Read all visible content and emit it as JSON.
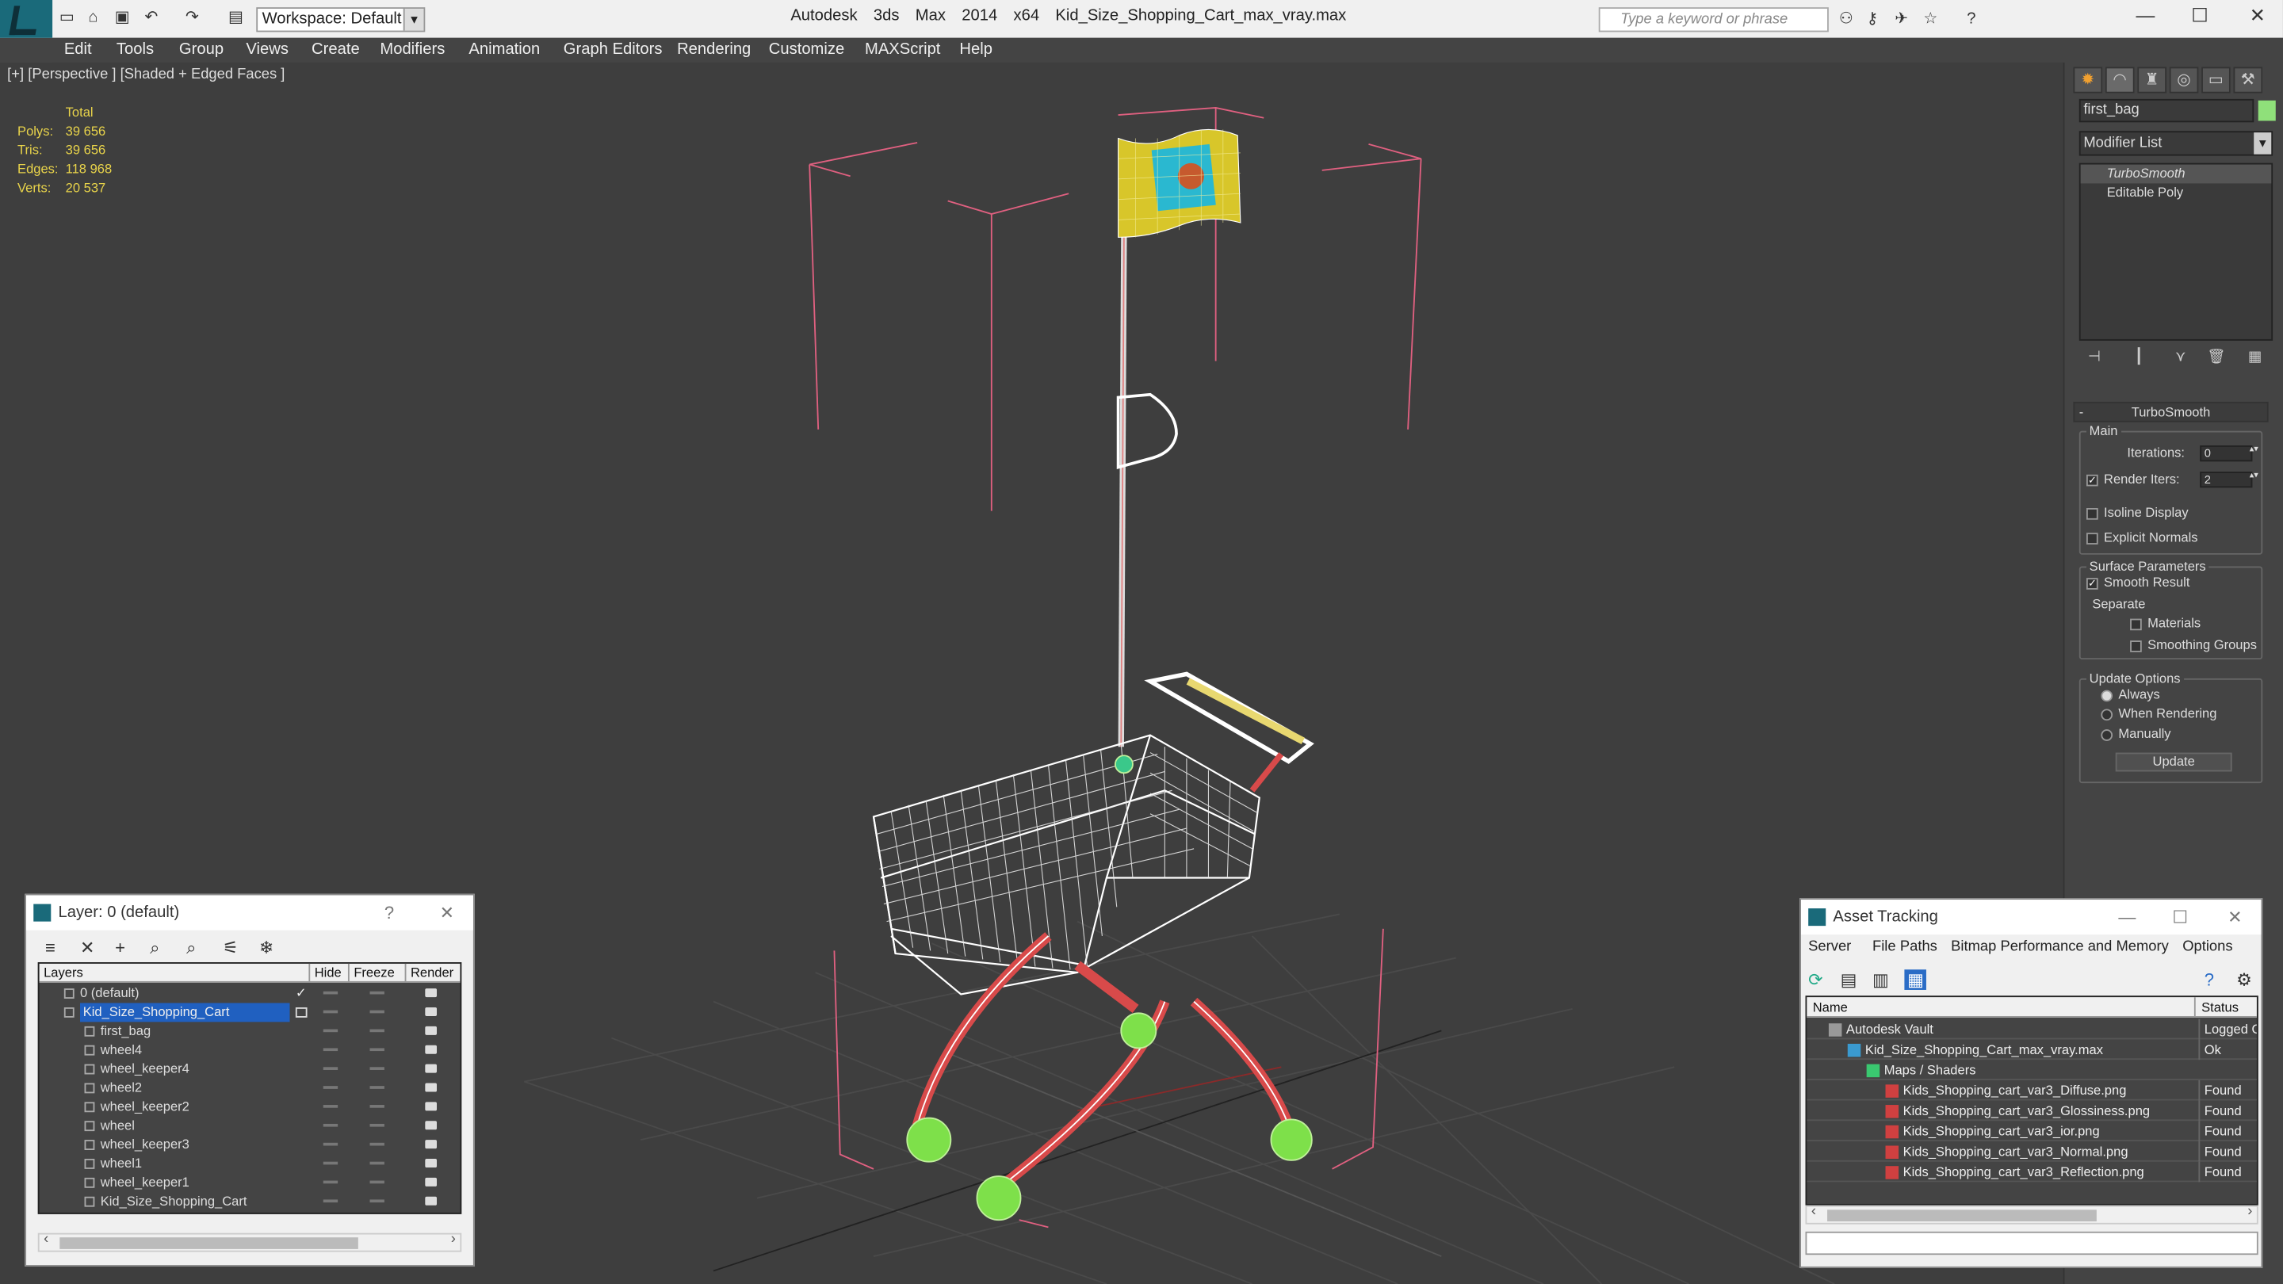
{
  "app": {
    "title": "Autodesk 3ds Max  2014 x64",
    "file": "Kid_Size_Shopping_Cart_max_vray.max",
    "workspace": "Workspace: Default",
    "search_placeholder": "Type a keyword or phrase"
  },
  "menu": [
    "Edit",
    "Tools",
    "Group",
    "Views",
    "Create",
    "Modifiers",
    "Animation",
    "Graph Editors",
    "Rendering",
    "Customize",
    "MAXScript",
    "Help"
  ],
  "viewport": {
    "label": "[+] [Perspective ] [Shaded + Edged Faces ]",
    "stats": {
      "header": "Total",
      "rows": [
        {
          "label": "Polys:",
          "value": "39 656"
        },
        {
          "label": "Tris:",
          "value": "39 656"
        },
        {
          "label": "Edges:",
          "value": "118 968"
        },
        {
          "label": "Verts:",
          "value": "20 537"
        }
      ]
    }
  },
  "command_panel": {
    "object_name": "first_bag",
    "object_color": "#8fe07a",
    "modifier_list": "Modifier List",
    "stack": [
      "TurboSmooth",
      "Editable Poly"
    ],
    "rollout_title": "TurboSmooth",
    "main_label": "Main",
    "iterations_label": "Iterations:",
    "iterations_value": "0",
    "render_iters_label": "Render Iters:",
    "render_iters_value": "2",
    "render_iters_checked": true,
    "isoline": "Isoline Display",
    "explicit": "Explicit Normals",
    "surface_label": "Surface Parameters",
    "smooth_result": "Smooth Result",
    "separate": "Separate",
    "materials": "Materials",
    "smoothing_groups": "Smoothing Groups",
    "update_options": "Update Options",
    "always": "Always",
    "when_rendering": "When Rendering",
    "manually": "Manually",
    "update_button": "Update"
  },
  "layer_window": {
    "title": "Layer: 0 (default)",
    "help": "?",
    "columns": [
      "Layers",
      "Hide",
      "Freeze",
      "Render"
    ],
    "rows": [
      {
        "name": "0 (default)",
        "indent": 1,
        "type": "layer",
        "check": "✓"
      },
      {
        "name": "Kid_Size_Shopping_Cart",
        "indent": 1,
        "type": "layer",
        "selected": true
      },
      {
        "name": "first_bag",
        "indent": 2,
        "type": "obj"
      },
      {
        "name": "wheel4",
        "indent": 2,
        "type": "obj"
      },
      {
        "name": "wheel_keeper4",
        "indent": 2,
        "type": "obj"
      },
      {
        "name": "wheel2",
        "indent": 2,
        "type": "obj"
      },
      {
        "name": "wheel_keeper2",
        "indent": 2,
        "type": "obj"
      },
      {
        "name": "wheel",
        "indent": 2,
        "type": "obj"
      },
      {
        "name": "wheel_keeper3",
        "indent": 2,
        "type": "obj"
      },
      {
        "name": "wheel1",
        "indent": 2,
        "type": "obj"
      },
      {
        "name": "wheel_keeper1",
        "indent": 2,
        "type": "obj"
      },
      {
        "name": "Kid_Size_Shopping_Cart",
        "indent": 2,
        "type": "obj"
      }
    ]
  },
  "asset_window": {
    "title": "Asset Tracking",
    "menu": [
      "Server",
      "File",
      "Paths",
      "Bitmap Performance and Memory",
      "Options"
    ],
    "columns": [
      "Name",
      "Status"
    ],
    "rows": [
      {
        "name": "Autodesk Vault",
        "status": "Logged Out",
        "indent": 1,
        "icon": "vault"
      },
      {
        "name": "Kid_Size_Shopping_Cart_max_vray.max",
        "status": "Ok",
        "indent": 2,
        "icon": "max"
      },
      {
        "name": "Maps / Shaders",
        "status": "",
        "indent": 3,
        "icon": "maps"
      },
      {
        "name": "Kids_Shopping_cart_var3_Diffuse.png",
        "status": "Found",
        "indent": 4,
        "icon": "png"
      },
      {
        "name": "Kids_Shopping_cart_var3_Glossiness.png",
        "status": "Found",
        "indent": 4,
        "icon": "png"
      },
      {
        "name": "Kids_Shopping_cart_var3_ior.png",
        "status": "Found",
        "indent": 4,
        "icon": "png"
      },
      {
        "name": "Kids_Shopping_cart_var3_Normal.png",
        "status": "Found",
        "indent": 4,
        "icon": "png"
      },
      {
        "name": "Kids_Shopping_cart_var3_Reflection.png",
        "status": "Found",
        "indent": 4,
        "icon": "png"
      }
    ]
  }
}
